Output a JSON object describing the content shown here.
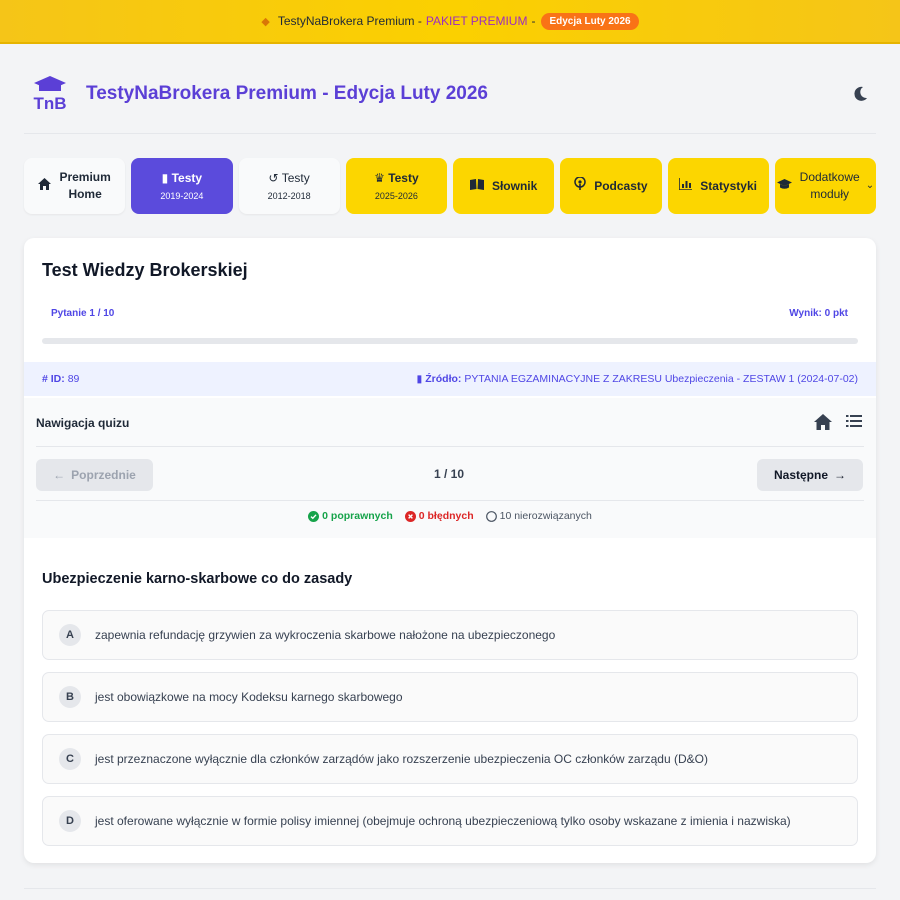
{
  "banner": {
    "name": "TestyNaBrokera Premium",
    "plan": "PAKIET PREMIUM",
    "badge": "Edycja Luty 2026"
  },
  "header": {
    "title": "TestyNaBrokera Premium - Edycja Luty 2026",
    "logo_text": "TnB"
  },
  "nav": {
    "home": {
      "line1": "Premium",
      "line2": "Home",
      "icon": "home-icon"
    },
    "tests_2019": {
      "label": "Testy",
      "sub": "2019-2024",
      "icon": "book-icon"
    },
    "tests_2012": {
      "label": "Testy",
      "sub": "2012-2018",
      "icon": "history-icon"
    },
    "tests_2025": {
      "label": "Testy",
      "sub": "2025-2026",
      "icon": "crown-icon"
    },
    "dictionary": {
      "label": "Słownik",
      "icon": "open-book-icon"
    },
    "podcasts": {
      "label": "Podcasty",
      "icon": "podcast-icon"
    },
    "stats": {
      "label": "Statystyki",
      "icon": "chart-icon"
    },
    "more": {
      "line1": "Dodatkowe",
      "line2": "moduły",
      "icon": "graduation-cap-icon"
    }
  },
  "quiz": {
    "title": "Test Wiedzy Brokerskiej",
    "question_counter": "Pytanie 1 / 10",
    "score": "Wynik: 0 pkt",
    "progress": 0,
    "id_label": "ID:",
    "id_value": "89",
    "source_label": "Źródło:",
    "source_value": "PYTANIA EGZAMINACYJNE Z ZAKRESU Ubezpieczenia - ZESTAW 1 (2024-07-02)"
  },
  "quiz_nav": {
    "title": "Nawigacja quizu",
    "prev": "Poprzednie",
    "next": "Następne",
    "pager": "1 / 10",
    "correct": "0 poprawnych",
    "wrong": "0 błędnych",
    "unanswered": "10 nierozwiązanych"
  },
  "question": {
    "text": "Ubezpieczenie karno-skarbowe co do zasady",
    "answers": [
      {
        "letter": "A",
        "text": "zapewnia refundację grzywien za wykroczenia skarbowe nałożone na ubezpieczonego"
      },
      {
        "letter": "B",
        "text": "jest obowiązkowe na mocy Kodeksu karnego skarbowego"
      },
      {
        "letter": "C",
        "text": "jest przeznaczone wyłącznie dla członków zarządów jako rozszerzenie ubezpieczenia OC członków zarządu (D&O)"
      },
      {
        "letter": "D",
        "text": "jest oferowane wyłącznie w formie polisy imiennej (obejmuje ochroną ubezpieczeniową tylko osoby wskazane z imienia i nazwiska)"
      }
    ]
  },
  "colors": {
    "accent": "#5b4bdc",
    "brand_yellow": "#fcd600",
    "badge_orange": "#f97316"
  }
}
